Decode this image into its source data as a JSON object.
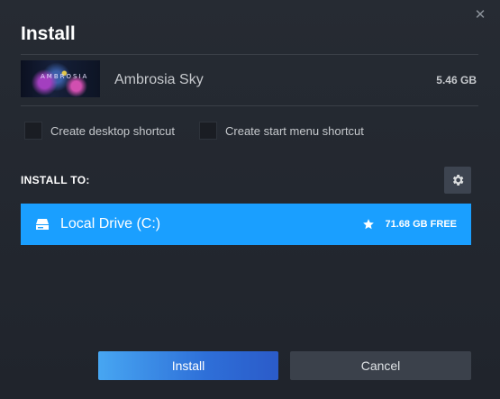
{
  "dialog": {
    "title": "Install",
    "close_icon": "close-icon"
  },
  "game": {
    "capsule_text": "AMBROSIA",
    "name": "Ambrosia Sky",
    "size": "5.46 GB"
  },
  "options": {
    "desktop_shortcut": {
      "label": "Create desktop shortcut",
      "checked": false
    },
    "start_menu_shortcut": {
      "label": "Create start menu shortcut",
      "checked": false
    }
  },
  "install_to": {
    "label": "INSTALL TO:",
    "settings_icon": "gear-icon",
    "drive": {
      "name": "Local Drive (C:)",
      "free": "71.68 GB FREE",
      "icon": "drive-icon",
      "default_icon": "star-icon",
      "color": "#1a9fff"
    }
  },
  "buttons": {
    "install": "Install",
    "cancel": "Cancel"
  }
}
